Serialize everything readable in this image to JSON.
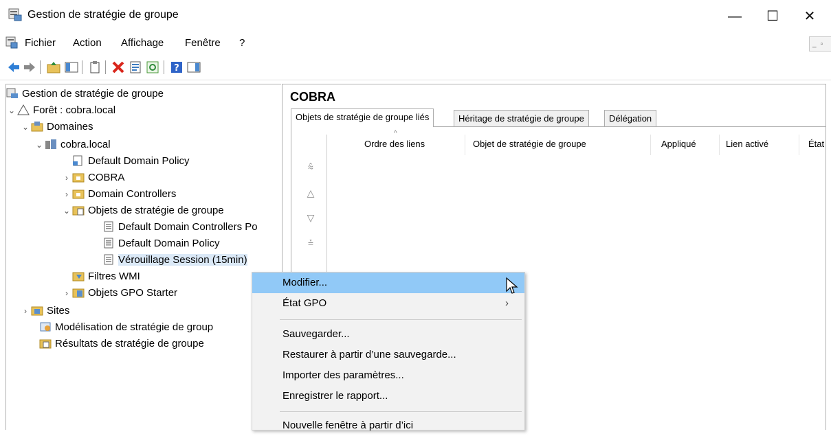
{
  "window": {
    "title": "Gestion de stratégie de groupe",
    "minimize": "—",
    "maximize": "☐",
    "close": "✕"
  },
  "menu": [
    "Fichier",
    "Action",
    "Affichage",
    "Fenêtre",
    "?"
  ],
  "tree": {
    "root": "Gestion de stratégie de groupe",
    "forest": "Forêt : cobra.local",
    "domains": "Domaines",
    "domain": "cobra.local",
    "default_policy": "Default Domain Policy",
    "ou_cobra": "COBRA",
    "ou_dc": "Domain Controllers",
    "gpo_container": "Objets de stratégie de groupe",
    "gpo_ddcp": "Default Domain Controllers Po",
    "gpo_ddp": "Default Domain Policy",
    "gpo_lock": "Vérouillage Session (15min)",
    "wmi": "Filtres WMI",
    "starter": "Objets GPO Starter",
    "sites": "Sites",
    "modeling": "Modélisation de stratégie de group",
    "results": "Résultats de stratégie de groupe"
  },
  "pane": {
    "title": "COBRA",
    "tabs": [
      "Objets de stratégie de groupe liés",
      "Héritage de stratégie de groupe",
      "Délégation"
    ],
    "columns": [
      "Ordre des liens",
      "Objet de stratégie de groupe",
      "Appliqué",
      "Lien activé",
      "État"
    ]
  },
  "context_menu": {
    "items": [
      "Modifier...",
      "État GPO",
      "Sauvegarder...",
      "Restaurer à partir d’une sauvegarde...",
      "Importer des paramètres...",
      "Enregistrer le rapport...",
      "Nouvelle fenêtre à partir d’ici"
    ],
    "submenu_arrow": "›"
  },
  "colors": {
    "selection": "#dbe9f7",
    "menu_highlight": "#91c9f7",
    "folder": "#e8c25a"
  }
}
